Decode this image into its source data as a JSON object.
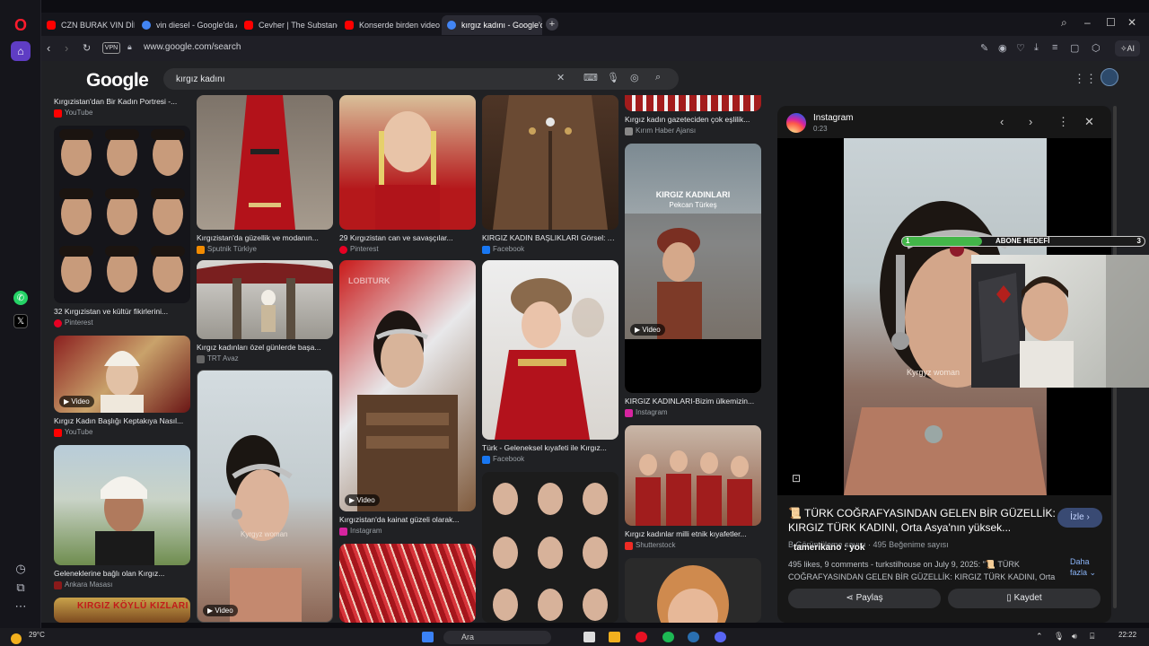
{
  "browser": {
    "tabs": [
      {
        "label": "CZN BURAK VIN DİESEL F…",
        "favicon_color": "#ff0000"
      },
      {
        "label": "vin diesel - Google'da Ara",
        "favicon_color": "#4285f4"
      },
      {
        "label": "Cevher | The Substance | …",
        "favicon_color": "#ff0000"
      },
      {
        "label": "Konserde birden videoya …",
        "favicon_color": "#ff0000"
      },
      {
        "label": "kırgız kadını - Google'da Ara",
        "favicon_color": "#4285f4"
      }
    ],
    "url": "www.google.com/search",
    "vpn_label": "VPN",
    "ai_label": "AI"
  },
  "google": {
    "logo": "Google",
    "query": "kırgız kadını"
  },
  "results": {
    "col1": [
      {
        "caption": "Kırgızistan'dan Bir Kadın Portresi -...",
        "source": "YouTube",
        "src_color": "#ff0000"
      },
      {
        "caption": "32 Kırgızistan ve kültür fikirlerini...",
        "source": "Pinterest",
        "src_color": "#e60023"
      },
      {
        "caption": "Kırgız Kadın Başlığı Keptakıya Nasıl...",
        "source": "YouTube",
        "src_color": "#ff0000",
        "video": "Video"
      },
      {
        "caption": "Geleneklerine bağlı olan Kırgız...",
        "source": "Ankara Masası",
        "src_color": "#8b1a1a"
      }
    ],
    "col2": [
      {
        "caption": "Kırgızistan'da güzellik ve modanın...",
        "source": "Sputnik Türkiye",
        "src_color": "#f28b00"
      },
      {
        "caption": "Kırgız kadınları özel günlerde başa...",
        "source": "TRT Avaz",
        "src_color": "#666666"
      },
      {
        "caption": "",
        "source": "",
        "video": "Video"
      }
    ],
    "col3": [
      {
        "caption": "29 Kırgızistan can ve savaşçılar...",
        "source": "Pinterest",
        "src_color": "#e60023"
      },
      {
        "caption": "Kırgızistan'da kainat güzeli olarak...",
        "source": "Instagram",
        "src_color": "#d6249f",
        "video": "Video",
        "watermark": "LOBITURK"
      }
    ],
    "col4": [
      {
        "caption": "KIRGIZ KADIN BAŞLIKLARI Görsel: Asi...",
        "source": "Facebook",
        "src_color": "#1877f2"
      },
      {
        "caption": "Türk - Geleneksel kıyafeti ile Kırgız...",
        "source": "Facebook",
        "src_color": "#1877f2"
      }
    ],
    "col5": [
      {
        "caption": "Kırgız kadın gazeteciden çok eşlilik...",
        "source": "Kırım Haber Ajansı",
        "src_color": "#888888"
      },
      {
        "caption": "KIRGIZ KADINLARI-Bizim ülkemizin...",
        "source": "Instagram",
        "src_color": "#d6249f",
        "video": "Video",
        "overlay_title": "KIRGIZ KADINLARI",
        "overlay_sub": "Pekcan Türkeş"
      },
      {
        "caption": "Kırgız kadınlar milli etnik kıyafetler...",
        "source": "Shutterstock",
        "src_color": "#ee2b24"
      }
    ],
    "bottom_banner": "KIRGIZ KÖYLÜ KIZLARI"
  },
  "preview": {
    "name": "Instagram",
    "duration": "0:23",
    "title": "📜 TÜRK COĞRAFYASINDAN GELEN BİR GÜZELLİK: KIRGIZ TÜRK KADINI, Orta Asya'nın yüksek...",
    "watch_label": "İzle",
    "views": "B Görüntüleme sayısı",
    "likes": "495 Beğenime sayısı",
    "description": "495 likes, 9 comments - turkstilhouse on July 9, 2025: \"📜 TÜRK COĞRAFYASINDAN GELEN BİR GÜZELLİK: KIRGIZ TÜRK KADINI, Orta",
    "more_label": "Daha fazla",
    "share_label": "Paylaş",
    "save_label": "Kaydet",
    "video_text": "Kyrgyz woman"
  },
  "stream": {
    "goal_label": "ABONE HEDEFİ",
    "goal_current": "1",
    "goal_target": "3",
    "goal_fraction": 0.33,
    "chat_user": "tamerikano",
    "chat_message": ": yok"
  },
  "taskbar": {
    "temp": "29°C",
    "search_label": "Ara",
    "time": "22:22"
  }
}
